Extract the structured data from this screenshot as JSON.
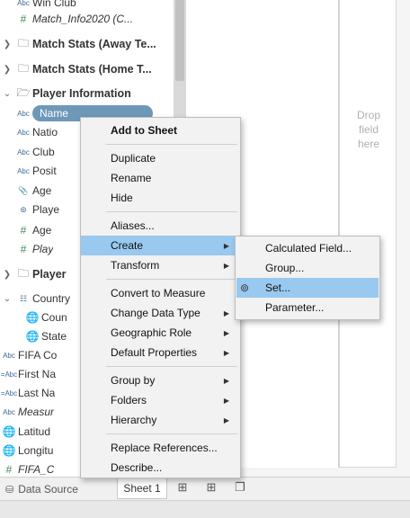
{
  "data_pane": {
    "partial_top": "Win Club",
    "match_info": "Match_Info2020 (C...",
    "folders": {
      "away": "Match Stats (Away Te...",
      "home": "Match Stats (Home T...",
      "player_info": "Player Information",
      "player": "Player",
      "country": "Country"
    },
    "fields": {
      "name": "Name",
      "nation": "Natio",
      "club": "Club",
      "position": "Posit",
      "age_clip": "Age",
      "player_set": "Playe",
      "age": "Age",
      "play": "Play",
      "country_sub": "Coun",
      "state": "State",
      "fifa_country": "FIFA Co",
      "first_name": "First Na",
      "last_name": "Last Na",
      "measure": "Measur",
      "latitude": "Latitud",
      "longitude": "Longitu",
      "fifa_c": "FIFA_C"
    },
    "type_labels": {
      "abc": "Abc",
      "eq_abc": "=Abc",
      "hash": "#"
    }
  },
  "view": {
    "drop_field_here": [
      "Drop",
      "field",
      "here"
    ]
  },
  "tabs": {
    "data_source": "Data Source",
    "sheet1": "Sheet 1"
  },
  "context_menu": {
    "add_to_sheet": "Add to Sheet",
    "duplicate": "Duplicate",
    "rename": "Rename",
    "hide": "Hide",
    "aliases": "Aliases...",
    "create": "Create",
    "transform": "Transform",
    "convert_to_measure": "Convert to Measure",
    "change_data_type": "Change Data Type",
    "geographic_role": "Geographic Role",
    "default_properties": "Default Properties",
    "group_by": "Group by",
    "folders": "Folders",
    "hierarchy": "Hierarchy",
    "replace_references": "Replace References...",
    "describe": "Describe..."
  },
  "create_submenu": {
    "calculated_field": "Calculated Field...",
    "group": "Group...",
    "set": "Set...",
    "parameter": "Parameter..."
  },
  "colors": {
    "highlight": "#99c9ef",
    "pill": "#6e98b8"
  }
}
